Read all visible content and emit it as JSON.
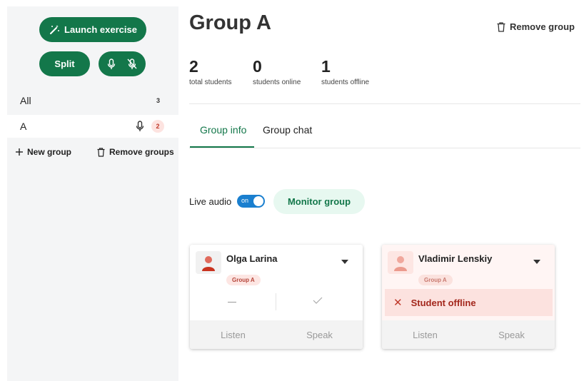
{
  "sidebar": {
    "launch_label": "Launch exercise",
    "split_label": "Split",
    "groups": [
      {
        "label": "All",
        "count": "3"
      },
      {
        "label": "A",
        "count": "2"
      }
    ],
    "new_group_label": "New group",
    "remove_groups_label": "Remove groups"
  },
  "main": {
    "title": "Group A",
    "remove_group_label": "Remove group",
    "stats": [
      {
        "value": "2",
        "label": "total students"
      },
      {
        "value": "0",
        "label": "students online"
      },
      {
        "value": "1",
        "label": "students offline"
      }
    ],
    "tabs": [
      {
        "label": "Group info",
        "active": true
      },
      {
        "label": "Group chat",
        "active": false
      }
    ],
    "live_audio_label": "Live audio",
    "toggle_label": "on",
    "monitor_label": "Monitor group",
    "students": [
      {
        "name": "Olga Larina",
        "group_tag": "Group A",
        "listen": "Listen",
        "speak": "Speak"
      },
      {
        "name": "Vladimir Lenskiy",
        "group_tag": "Group A",
        "status": "Student offline",
        "listen": "Listen",
        "speak": "Speak"
      }
    ]
  },
  "colors": {
    "primary_green": "#13774a",
    "toggle_blue": "#1a7fcf",
    "offline_red": "#a3271c",
    "avatar_red": "#d8402f"
  },
  "icons": [
    "magic-wand-icon",
    "mic-icon",
    "mic-off-icon",
    "trash-icon",
    "plus-icon",
    "user-icon",
    "caret-down-icon",
    "check-icon",
    "close-icon"
  ]
}
